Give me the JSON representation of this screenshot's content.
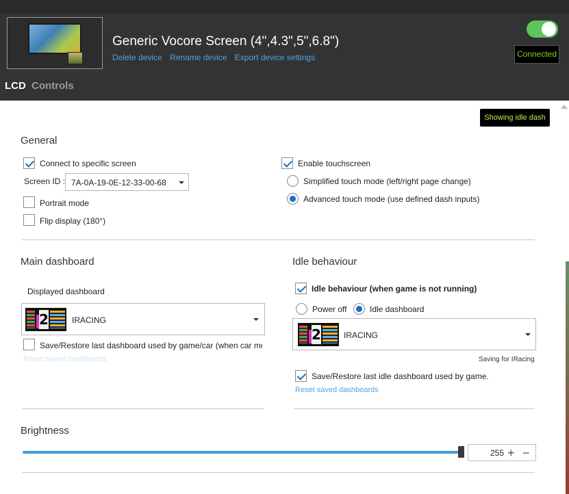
{
  "device": {
    "title": "Generic Vocore Screen (4\",4.3\",5\",6.8\")",
    "links": [
      "Delete device",
      "Rename device",
      "Export device settings"
    ],
    "status": "Connected",
    "enabled": true
  },
  "tabs": [
    "LCD",
    "Controls"
  ],
  "badge": "Showing idle dash",
  "general": {
    "heading": "General",
    "connect_specific": {
      "label": "Connect to specific screen",
      "checked": true
    },
    "screen_id_label": "Screen ID :",
    "screen_id_value": "7A-0A-19-0E-12-33-00-68",
    "portrait": {
      "label": "Portrait mode",
      "checked": false
    },
    "flip": {
      "label": "Flip display (180°)",
      "checked": false
    },
    "touch": {
      "label": "Enable touchscreen",
      "checked": true
    },
    "simplified_touch": {
      "label": "Simplified touch mode (left/right page change)",
      "selected": false
    },
    "advanced_touch": {
      "label": "Advanced touch mode (use defined dash inputs)",
      "selected": true
    }
  },
  "main_dashboard": {
    "heading": "Main dashboard",
    "displayed_label": "Displayed dashboard",
    "dashboard_name": "IRACING",
    "thumb_number": "2",
    "save_restore": {
      "label": "Save/Restore last dashboard used by game/car (when car mo",
      "checked": false
    },
    "reset_link": "Reset saved dashboards"
  },
  "idle": {
    "heading": "Idle behaviour",
    "behaviour": {
      "label": "Idle behaviour (when game is not running)",
      "checked": true
    },
    "power_off": {
      "label": "Power off",
      "selected": false
    },
    "idle_dashboard": {
      "label": "Idle dashboard",
      "selected": true
    },
    "dashboard_name": "IRACING",
    "thumb_number": "2",
    "saving_for": "Saving for IRacing",
    "save_restore": {
      "label": "Save/Restore last idle dashboard used by game.",
      "checked": true
    },
    "reset_link": "Reset saved dashboards"
  },
  "brightness": {
    "heading": "Brightness",
    "value": "255",
    "level": 1.0,
    "plus": "+",
    "minus": "−"
  }
}
